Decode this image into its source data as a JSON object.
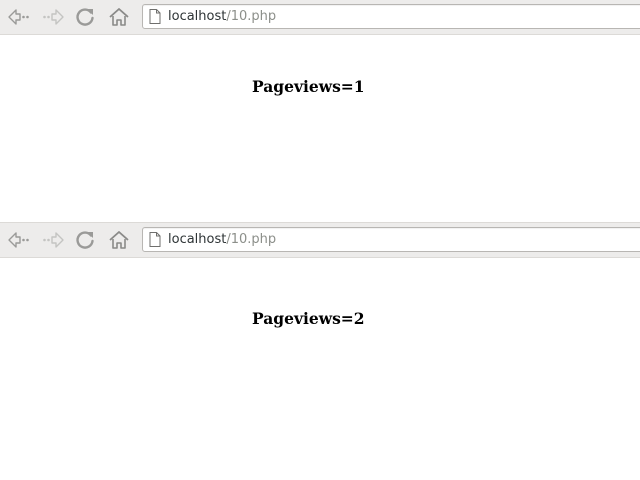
{
  "screens": [
    {
      "address_bar": {
        "host": "localhost",
        "path": "/10.php"
      },
      "page_text": "Pageviews=1"
    },
    {
      "address_bar": {
        "host": "localhost",
        "path": "/10.php"
      },
      "page_text": "Pageviews=2"
    }
  ],
  "icons": {
    "back": "back-arrow-icon",
    "forward": "forward-arrow-icon",
    "reload": "reload-icon",
    "home": "home-icon",
    "page": "page-icon"
  },
  "colors": {
    "toolbar_bg": "#edeceb",
    "url_host": "#2e3436",
    "url_path": "#8c8f8a"
  }
}
